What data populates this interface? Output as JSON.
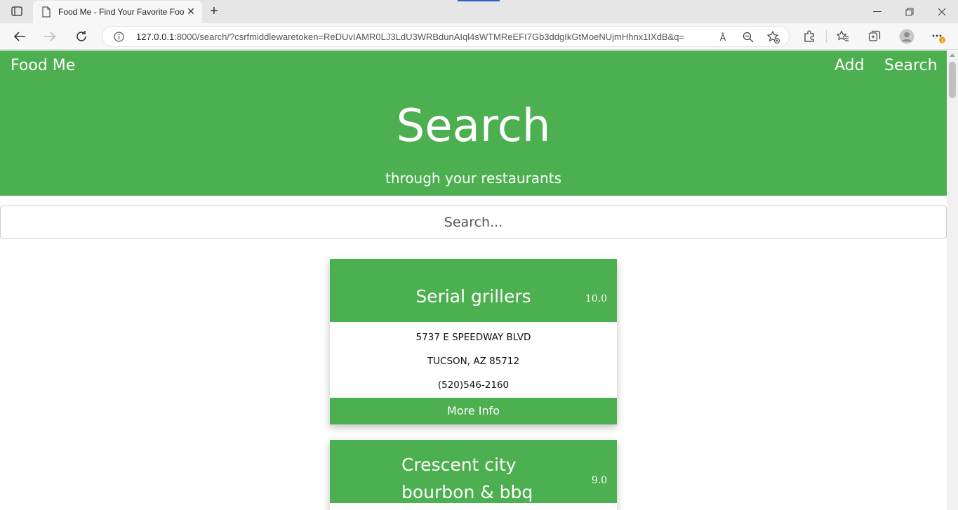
{
  "browser": {
    "tab_title": "Food Me - Find Your Favorite Foo",
    "url_host": "127.0.0.1",
    "url_rest": ":8000/search/?csrfmiddlewaretoken=ReDUvIAMR0LJ3LdU3WRBdunAIql4sWTMReEFI7Gb3ddgIkGtMoeNUjmHhnx1IXdB&q=",
    "read_aloud_label": "Â",
    "notification_badge": "!"
  },
  "nav": {
    "brand": "Food Me",
    "links": [
      "Add",
      "Search"
    ]
  },
  "hero": {
    "title": "Search",
    "subtitle": "through your restaurants"
  },
  "search": {
    "placeholder": "Search..."
  },
  "restaurants": [
    {
      "name": "Serial grillers",
      "rating": "10.0",
      "address": "5737 E SPEEDWAY BLVD",
      "city": "TUCSON, AZ 85712",
      "phone": "(520)546-2160",
      "button": "More Info"
    },
    {
      "name_line1": "Crescent city",
      "name_line2": "bourbon & bbq",
      "rating": "9.0"
    }
  ],
  "colors": {
    "brand_green": "#4caf50"
  }
}
